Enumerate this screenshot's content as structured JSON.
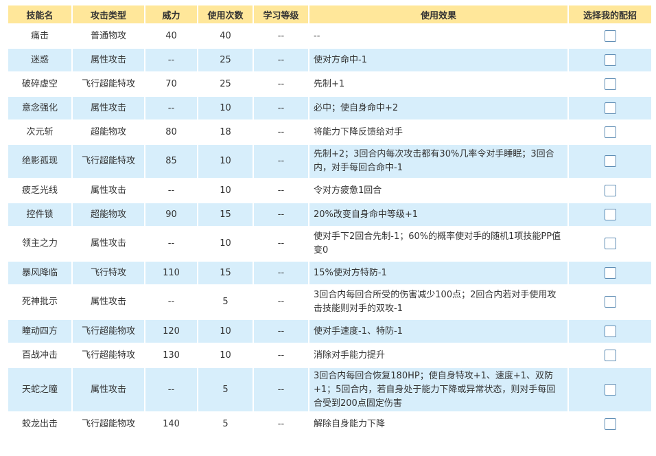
{
  "headers": {
    "name": "技能名",
    "type": "攻击类型",
    "power": "威力",
    "uses": "使用次数",
    "level": "学习等级",
    "effect": "使用效果",
    "select": "选择我的配招"
  },
  "skills": [
    {
      "name": "痛击",
      "type": "普通物攻",
      "power": "40",
      "uses": "40",
      "level": "--",
      "effect": "--"
    },
    {
      "name": "迷惑",
      "type": "属性攻击",
      "power": "--",
      "uses": "25",
      "level": "--",
      "effect": "使对方命中-1"
    },
    {
      "name": "破碎虚空",
      "type": "飞行超能特攻",
      "power": "70",
      "uses": "25",
      "level": "--",
      "effect": "先制+1"
    },
    {
      "name": "意念强化",
      "type": "属性攻击",
      "power": "--",
      "uses": "10",
      "level": "--",
      "effect": "必中；使自身命中+2"
    },
    {
      "name": "次元斩",
      "type": "超能物攻",
      "power": "80",
      "uses": "18",
      "level": "--",
      "effect": "将能力下降反馈给对手"
    },
    {
      "name": "绝影孤现",
      "type": "飞行超能特攻",
      "power": "85",
      "uses": "10",
      "level": "--",
      "effect": "先制+2；3回合内每次攻击都有30%几率令对手睡眠；3回合内，对手每回合命中-1"
    },
    {
      "name": "疲乏光线",
      "type": "属性攻击",
      "power": "--",
      "uses": "10",
      "level": "--",
      "effect": "令对方疲惫1回合"
    },
    {
      "name": "控件锁",
      "type": "超能物攻",
      "power": "90",
      "uses": "15",
      "level": "--",
      "effect": "20%改变自身命中等级+1"
    },
    {
      "name": "领主之力",
      "type": "属性攻击",
      "power": "--",
      "uses": "10",
      "level": "--",
      "effect": "使对手下2回合先制-1；60%的概率使对手的随机1项技能PP值变0"
    },
    {
      "name": "暴风降临",
      "type": "飞行特攻",
      "power": "110",
      "uses": "15",
      "level": "--",
      "effect": "15%使对方特防-1"
    },
    {
      "name": "死神批示",
      "type": "属性攻击",
      "power": "--",
      "uses": "5",
      "level": "--",
      "effect": "3回合内每回合所受的伤害减少100点；2回合内若对手使用攻击技能则对手的双攻-1"
    },
    {
      "name": "瞳动四方",
      "type": "飞行超能物攻",
      "power": "120",
      "uses": "10",
      "level": "--",
      "effect": "使对手速度-1、特防-1"
    },
    {
      "name": "百战冲击",
      "type": "飞行超能特攻",
      "power": "130",
      "uses": "10",
      "level": "--",
      "effect": "消除对手能力提升"
    },
    {
      "name": "天蛇之瞳",
      "type": "属性攻击",
      "power": "--",
      "uses": "5",
      "level": "--",
      "effect": "3回合内每回合恢复180HP；使自身特攻+1、速度+1、双防+1；5回合内，若自身处于能力下降或异常状态，则对手每回合受到200点固定伤害"
    },
    {
      "name": "蛟龙出击",
      "type": "飞行超能物攻",
      "power": "140",
      "uses": "5",
      "level": "--",
      "effect": "解除自身能力下降"
    }
  ]
}
